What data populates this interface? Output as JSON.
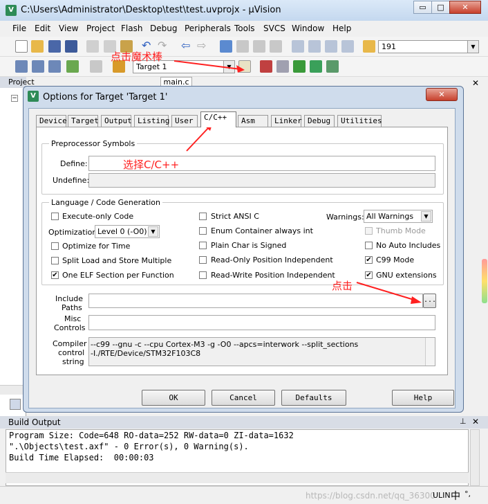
{
  "window": {
    "title": "C:\\Users\\Administrator\\Desktop\\test\\test.uvprojx - µVision",
    "app_icon": "V",
    "controls": {
      "minimize": "▭",
      "maximize": "□",
      "close": "✕"
    }
  },
  "menu": [
    "File",
    "Edit",
    "View",
    "Project",
    "Flash",
    "Debug",
    "Peripherals",
    "Tools",
    "SVCS",
    "Window",
    "Help"
  ],
  "toolbar": {
    "find_value": "191",
    "target_value": "Target 1"
  },
  "project_panel": {
    "title": "Project",
    "tab_main": "main.c"
  },
  "annotations": {
    "magic_wand": "点击魔术棒",
    "select_cpp": "选择C/C++",
    "click": "点击"
  },
  "dialog": {
    "title": "Options for Target 'Target 1'",
    "close": "✕",
    "tabs": [
      "Device",
      "Target",
      "Output",
      "Listing",
      "User",
      "C/C++",
      "Asm",
      "Linker",
      "Debug",
      "Utilities"
    ],
    "active_tab": "C/C++",
    "preprocessor": {
      "group_label": "Preprocessor Symbols",
      "define_label": "Define:",
      "define_value": "",
      "undefine_label": "Undefine:",
      "undefine_value": ""
    },
    "language": {
      "group_label": "Language / Code Generation",
      "execute_only": {
        "label": "Execute-only Code",
        "checked": false
      },
      "optimization_label": "Optimization:",
      "optimization_value": "Level 0 (-O0)",
      "optimize_time": {
        "label": "Optimize for Time",
        "checked": false
      },
      "split_load": {
        "label": "Split Load and Store Multiple",
        "checked": false
      },
      "one_elf": {
        "label": "One ELF Section per Function",
        "checked": true
      },
      "strict_ansi": {
        "label": "Strict ANSI C",
        "checked": false
      },
      "enum_int": {
        "label": "Enum Container always int",
        "checked": false
      },
      "plain_char": {
        "label": "Plain Char is Signed",
        "checked": false
      },
      "ro_pi": {
        "label": "Read-Only Position Independent",
        "checked": false
      },
      "rw_pi": {
        "label": "Read-Write Position Independent",
        "checked": false
      },
      "warnings_label": "Warnings:",
      "warnings_value": "All Warnings",
      "thumb_mode": {
        "label": "Thumb Mode",
        "checked": false,
        "disabled": true
      },
      "no_auto_includes": {
        "label": "No Auto Includes",
        "checked": false
      },
      "c99_mode": {
        "label": "C99 Mode",
        "checked": true
      },
      "gnu_ext": {
        "label": "GNU extensions",
        "checked": true
      }
    },
    "include_paths": {
      "label1": "Include",
      "label2": "Paths",
      "value": "",
      "browse": "..."
    },
    "misc_controls": {
      "label1": "Misc",
      "label2": "Controls",
      "value": ""
    },
    "compiler_string": {
      "label1": "Compiler",
      "label2": "control",
      "label3": "string",
      "line1": "--c99 --gnu -c --cpu Cortex-M3 -g -O0 --apcs=interwork --split_sections",
      "line2": "-I./RTE/Device/STM32F103C8"
    },
    "buttons": {
      "ok": "OK",
      "cancel": "Cancel",
      "defaults": "Defaults",
      "help": "Help"
    }
  },
  "build_output": {
    "title": "Build Output",
    "lines": [
      "Program Size: Code=648 RO-data=252 RW-data=0 ZI-data=1632",
      "\".\\Objects\\test.axf\" - 0 Error(s), 0 Warning(s).",
      "Build Time Elapsed:  00:00:03"
    ]
  },
  "status": {
    "text": "ULIN",
    "ime": "中",
    "ime_punct": "°,",
    "watermark": "https://blog.csdn.net/qq_36300"
  },
  "colors": {
    "annotation_red": "#ff2020",
    "dialog_frame": "#cfdcec"
  }
}
